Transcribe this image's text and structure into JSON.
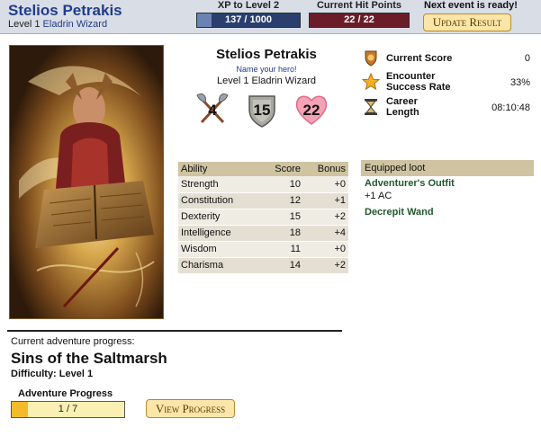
{
  "header": {
    "character_name": "Stelios Petrakis",
    "level_prefix": "Level 1",
    "class_name": "Eladrin Wizard",
    "xp_label": "XP to Level 2",
    "xp_value": "137 / 1000",
    "xp_progress": 0.137,
    "hp_label": "Current Hit Points",
    "hp_value": "22 / 22",
    "next_event": "Next event is ready!",
    "update_button": "Update Result"
  },
  "identity": {
    "name": "Stelios Petrakis",
    "name_prompt": "Name your hero!",
    "level_class": "Level 1 Eladrin Wizard",
    "attack": "4",
    "defense": "15",
    "health": "22",
    "icons": [
      "crossed-axes-icon",
      "shield-icon",
      "heart-icon"
    ]
  },
  "abilities": {
    "headers": [
      "Ability",
      "Score",
      "Bonus"
    ],
    "rows": [
      {
        "name": "Strength",
        "score": "10",
        "bonus": "+0"
      },
      {
        "name": "Constitution",
        "score": "12",
        "bonus": "+1"
      },
      {
        "name": "Dexterity",
        "score": "15",
        "bonus": "+2"
      },
      {
        "name": "Intelligence",
        "score": "18",
        "bonus": "+4"
      },
      {
        "name": "Wisdom",
        "score": "11",
        "bonus": "+0"
      },
      {
        "name": "Charisma",
        "score": "14",
        "bonus": "+2"
      }
    ]
  },
  "score": {
    "current_label": "Current Score",
    "current_value": "0",
    "encounter_label_1": "Encounter",
    "encounter_label_2": "Success Rate",
    "encounter_value": "33%",
    "career_label_1": "Career",
    "career_label_2": "Length",
    "career_value": "08:10:48"
  },
  "loot": {
    "header": "Equipped loot",
    "items": [
      {
        "name": "Adventurer's Outfit",
        "desc": "+1 AC"
      },
      {
        "name": "Decrepit Wand",
        "desc": ""
      }
    ]
  },
  "adventure": {
    "current_label": "Current adventure progress:",
    "title": "Sins of the Saltmarsh",
    "difficulty_label": "Difficulty:",
    "difficulty_value": "Level 1",
    "progress_label": "Adventure Progress",
    "progress_value": "1 / 7",
    "progress_fraction": 0.143,
    "view_button": "View Progress"
  },
  "colors": {
    "header_bg": "#d9dde6",
    "xp_bar": "#2a3f6e",
    "hp_bar": "#6a1d29",
    "button_bg": "#fbe6a8",
    "table_header": "#cfc3a2",
    "loot_name": "#1f5a2e"
  }
}
